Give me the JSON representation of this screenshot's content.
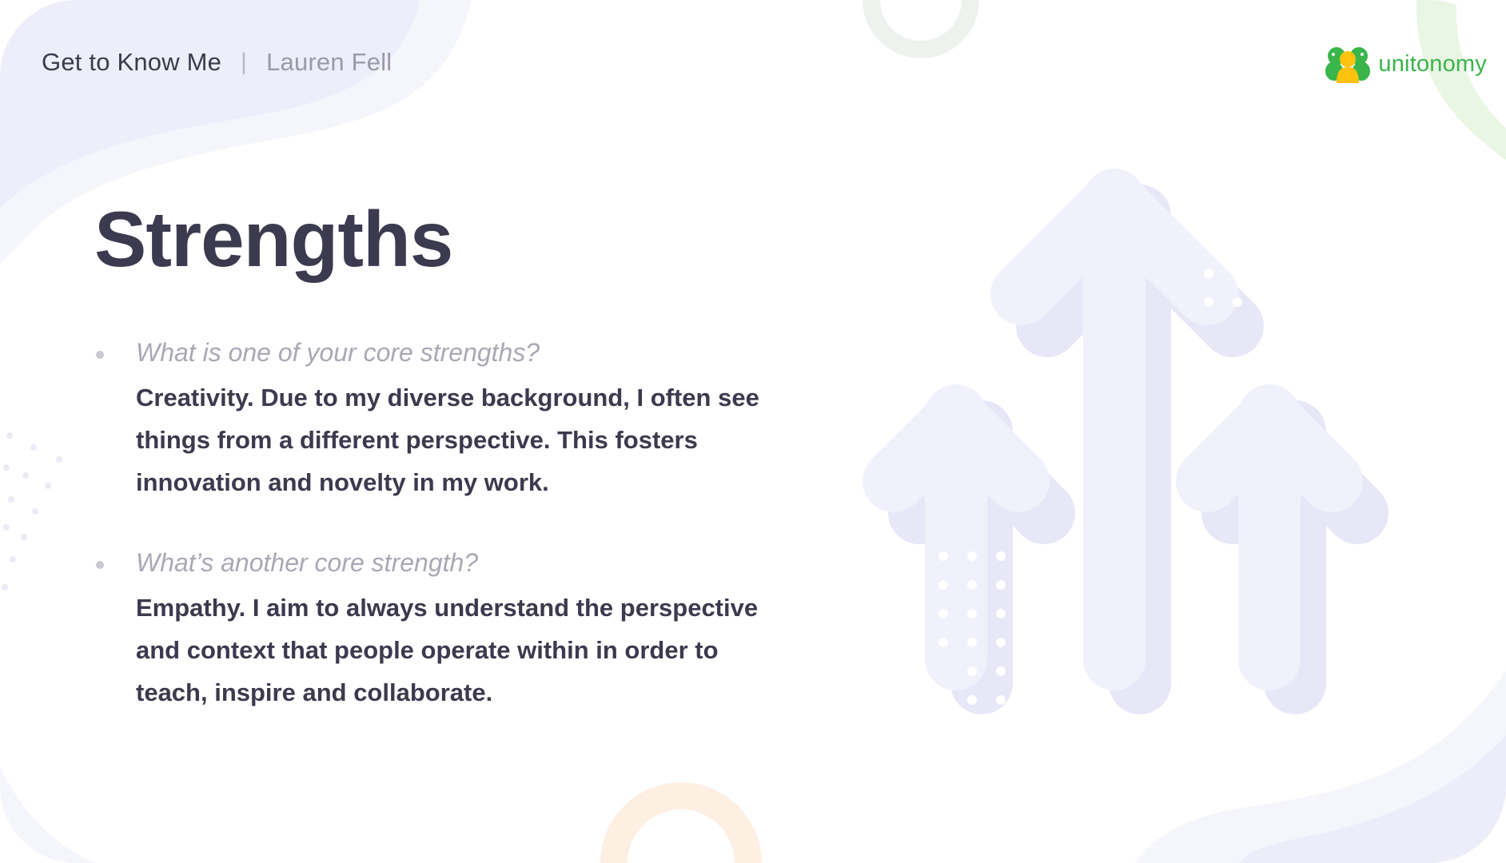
{
  "header": {
    "title": "Get to Know Me",
    "separator": "|",
    "name": "Lauren Fell"
  },
  "logo": {
    "icon": "people-group-icon",
    "text": "unitonomy",
    "color": "#39b54a"
  },
  "slide": {
    "title": "Strengths",
    "items": [
      {
        "question": "What is one of your core strengths?",
        "answer": "Creativity. Due to my diverse background, I often see things from a different perspective. This fosters innovation and novelty in my work."
      },
      {
        "question": "What’s another core strength?",
        "answer": "Empathy. I aim to always understand the perspective and context that people operate within in order to teach, inspire and collaborate."
      }
    ]
  },
  "decor": {
    "illustration": "three-up-arrows-illustration"
  },
  "colors": {
    "text_dark": "#3b3a4e",
    "text_muted": "#a9a8b5",
    "lavender": "#ececfa",
    "green_accent": "#e5f4de",
    "peach_accent": "#fdefe2"
  }
}
